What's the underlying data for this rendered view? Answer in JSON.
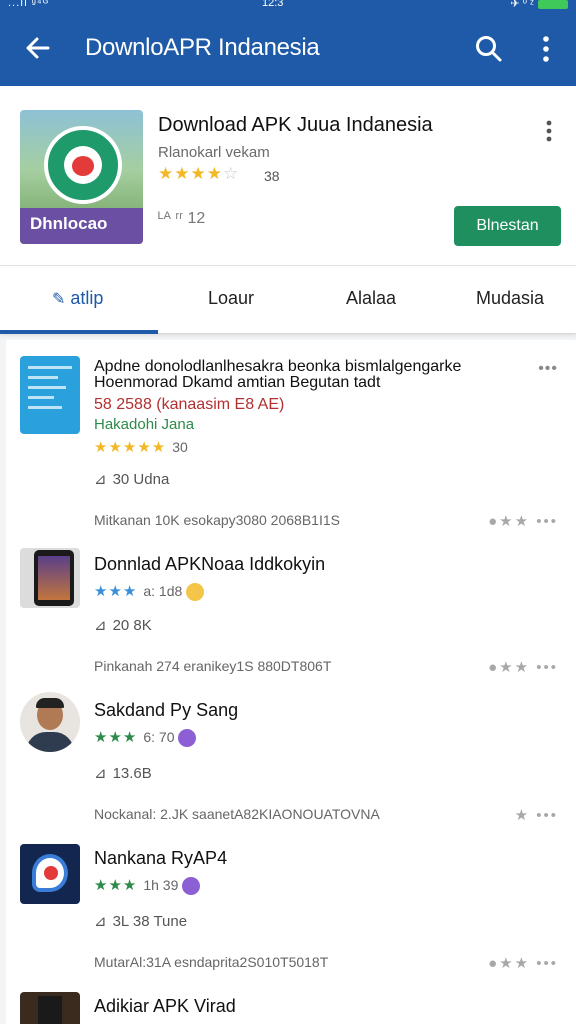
{
  "status": {
    "left": "...ıl ᵍ⁴ᴳ",
    "time": "12:3",
    "right": "✈ ⁰ ᶻ"
  },
  "appbar": {
    "title": "DownloAPR Indanesia"
  },
  "featured": {
    "title": "Download APK Juua Indanesia",
    "subtitle": "Rlanokarl vekam",
    "stars": "★★★★",
    "stars_empty": "☆",
    "rating_count": "38",
    "meta": "ᴸᴬ ʳʳ 12",
    "icon_banner": "Dhnlocao",
    "install_label": "Blnestan"
  },
  "tabs": [
    {
      "label": "atlip",
      "active": true
    },
    {
      "label": "Loaur"
    },
    {
      "label": "Alalaa"
    },
    {
      "label": "Mudasia"
    }
  ],
  "items": [
    {
      "name": "Apdne donolodlanlhesakra beonka bismlalgengarke",
      "name_line2": "Hoenmorad Dkamd amtian Begutan tadt",
      "red": "58 2588 (kanaasim E8 AE)",
      "green": "Hakadohi Jana",
      "stars": "★★★★★",
      "rating": "30",
      "downloads": "30 Udna",
      "footer": "Mitkanan 10K   esokapy3080 2068B1I1S",
      "actions": "●★★ •••",
      "kebab": "•••"
    },
    {
      "name": "Donnlad APKNoaa Iddkokyin",
      "stars": "★★★",
      "rating": "a: 1d8",
      "downloads": "20 8K",
      "footer": "Pinkanah 274   eranikey1S 880DT806T",
      "actions": "●★★ •••"
    },
    {
      "name": "Sakdand Py Sang",
      "stars": "★★★",
      "rating": "6: 70",
      "downloads": "13.6B",
      "footer": "Nockanal: 2.JK   saanetA82KIAONOUATOVNA",
      "actions": "★ •••"
    },
    {
      "name": "Nankana RyAP4",
      "stars": "★★★",
      "rating": "1h 39",
      "downloads": "3L 38   Tune",
      "footer": "MutarAl:31A   esndaprita2S010T5018T",
      "actions": "●★★ •••"
    },
    {
      "name": "Adikiar APK Virad"
    }
  ]
}
